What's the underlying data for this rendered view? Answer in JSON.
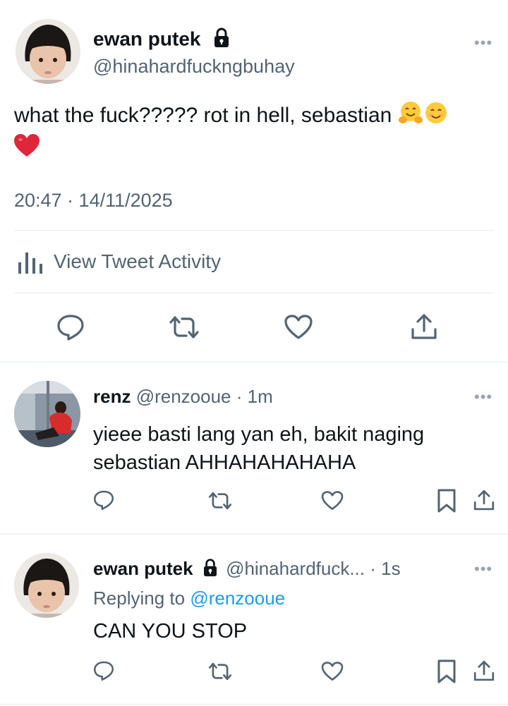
{
  "main_tweet": {
    "display_name": "ewan putek",
    "handle": "@hinahardfuckngbuhay",
    "text": "what the fuck????? rot in hell, sebastian",
    "timestamp": "20:47 · 14/11/2025",
    "activity_label": "View Tweet Activity"
  },
  "replies": [
    {
      "display_name": "renz",
      "handle": "@renzooue",
      "time": "· 1m",
      "text_line1": "yieee basti lang yan eh, bakit naging",
      "text_line2": "sebastian AHHAHAHAHAHA"
    },
    {
      "display_name": "ewan putek",
      "handle": "@hinahardfuck...",
      "time": "· 1s",
      "replying_prefix": "Replying to",
      "replying_to": "@renzooue",
      "text": "CAN YOU STOP"
    }
  ],
  "colors": {
    "text": "#0f1419",
    "muted": "#536471",
    "link": "#1d9bf0",
    "divider": "#e6ecf0"
  },
  "icons": [
    "lock-icon",
    "more-icon",
    "stats-icon",
    "reply-icon",
    "retweet-icon",
    "like-icon",
    "share-icon",
    "bookmark-icon",
    "hug-emoji",
    "smile-emoji",
    "heart-emoji"
  ]
}
